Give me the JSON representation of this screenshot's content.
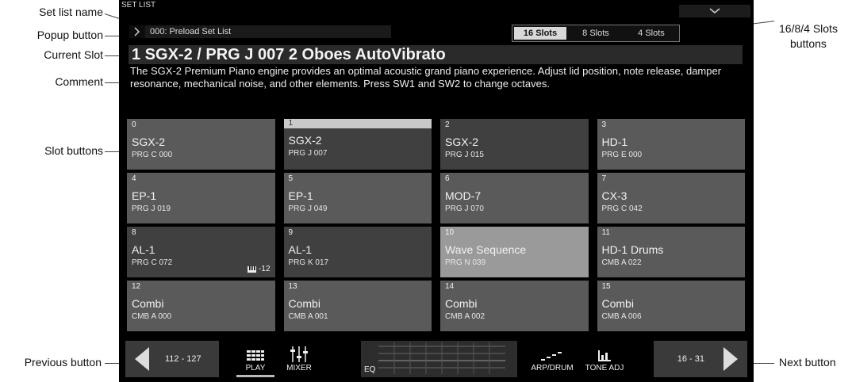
{
  "callouts": {
    "set_list_name": "Set list name",
    "popup_button": "Popup button",
    "current_slot": "Current Slot",
    "comment": "Comment",
    "slot_buttons": "Slot buttons",
    "previous_button": "Previous button",
    "slots_buttons": "16/8/4 Slots",
    "slots_buttons_2": "buttons",
    "next_button": "Next button"
  },
  "header": {
    "title": "SET LIST",
    "set_list_name": "000: Preload Set List"
  },
  "slot_sizes": [
    "16 Slots",
    "8 Slots",
    "4 Slots"
  ],
  "current_slot": "1 SGX-2 / PRG J 007 2 Oboes AutoVibrato",
  "comment": "The SGX-2 Premium Piano engine provides an optimal acoustic grand piano experience.  Adjust lid position, note release, damper resonance, mechanical noise, and other elements.  Press SW1 and SW2 to change octaves.",
  "slots": [
    {
      "num": "0",
      "name": "SGX-2",
      "prog": "PRG C 000"
    },
    {
      "num": "1",
      "name": "SGX-2",
      "prog": "PRG J 007"
    },
    {
      "num": "2",
      "name": "SGX-2",
      "prog": "PRG J 015"
    },
    {
      "num": "3",
      "name": "HD-1",
      "prog": "PRG E 000"
    },
    {
      "num": "4",
      "name": "EP-1",
      "prog": "PRG J 019"
    },
    {
      "num": "5",
      "name": "EP-1",
      "prog": "PRG J 049"
    },
    {
      "num": "6",
      "name": "MOD-7",
      "prog": "PRG J 070"
    },
    {
      "num": "7",
      "name": "CX-3",
      "prog": "PRG C 042"
    },
    {
      "num": "8",
      "name": "AL-1",
      "prog": "PRG C 072",
      "transpose": "-12"
    },
    {
      "num": "9",
      "name": "AL-1",
      "prog": "PRG K 017"
    },
    {
      "num": "10",
      "name": "Wave Sequence",
      "prog": "PRG N 039"
    },
    {
      "num": "11",
      "name": "HD-1 Drums",
      "prog": "CMB A 022"
    },
    {
      "num": "12",
      "name": "Combi",
      "prog": "CMB A 000"
    },
    {
      "num": "13",
      "name": "Combi",
      "prog": "CMB A 001"
    },
    {
      "num": "14",
      "name": "Combi",
      "prog": "CMB A 002"
    },
    {
      "num": "15",
      "name": "Combi",
      "prog": "CMB A 006"
    }
  ],
  "bottom": {
    "prev_range": "112 - 127",
    "next_range": "16 - 31",
    "tabs": {
      "play": "PLAY",
      "mixer": "MIXER",
      "eq": "EQ",
      "arp": "ARP/DRUM",
      "tone": "TONE ADJ"
    }
  }
}
